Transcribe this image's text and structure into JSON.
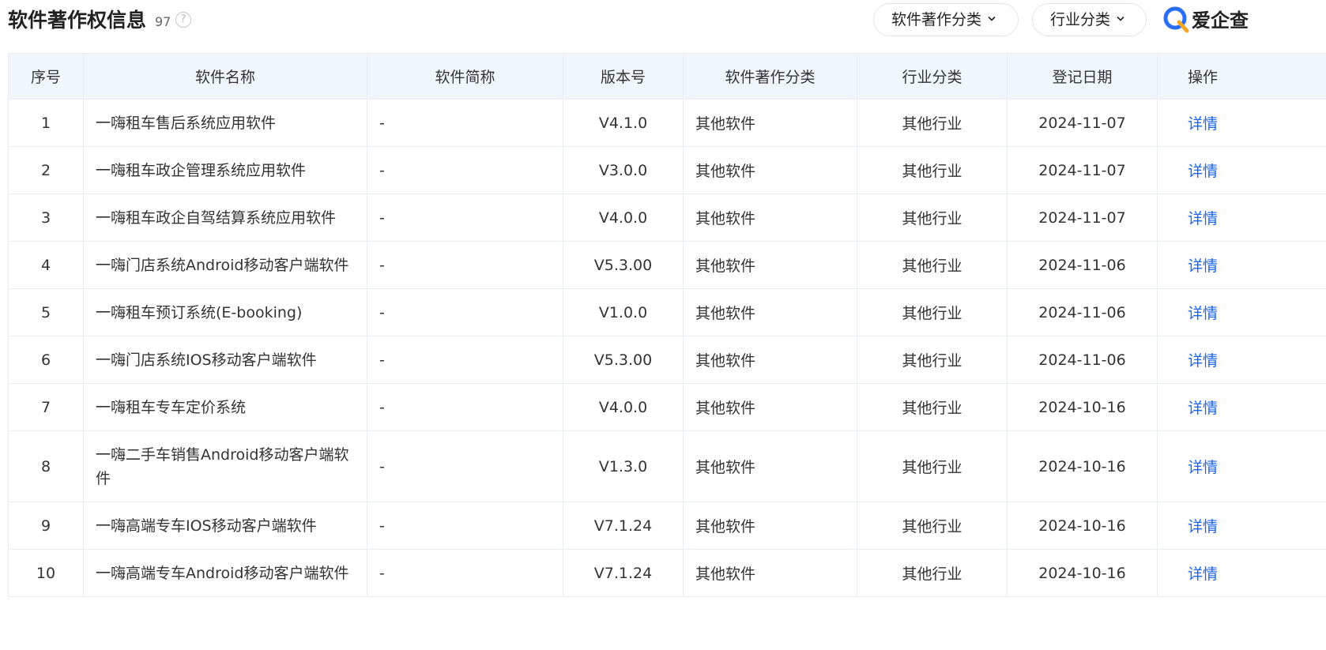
{
  "header": {
    "title": "软件著作权信息",
    "count": "97",
    "help_glyph": "?",
    "filters": [
      {
        "label": "软件著作分类",
        "icon": "chevron-down-icon"
      },
      {
        "label": "行业分类",
        "icon": "chevron-down-icon"
      }
    ],
    "brand": {
      "text": "爱企查",
      "logo_icon": "aiqicha-logo-icon",
      "accent": "#2a6ef5"
    }
  },
  "table": {
    "columns": [
      "序号",
      "软件名称",
      "软件简称",
      "版本号",
      "软件著作分类",
      "行业分类",
      "登记日期",
      "操作"
    ],
    "rows": [
      {
        "index": "1",
        "name": "一嗨租车售后系统应用软件",
        "abbr": "-",
        "version": "V4.1.0",
        "category": "其他软件",
        "industry": "其他行业",
        "date": "2024-11-07",
        "action": "详情"
      },
      {
        "index": "2",
        "name": "一嗨租车政企管理系统应用软件",
        "abbr": "-",
        "version": "V3.0.0",
        "category": "其他软件",
        "industry": "其他行业",
        "date": "2024-11-07",
        "action": "详情"
      },
      {
        "index": "3",
        "name": "一嗨租车政企自驾结算系统应用软件",
        "abbr": "-",
        "version": "V4.0.0",
        "category": "其他软件",
        "industry": "其他行业",
        "date": "2024-11-07",
        "action": "详情"
      },
      {
        "index": "4",
        "name": "一嗨门店系统Android移动客户端软件",
        "abbr": "-",
        "version": "V5.3.00",
        "category": "其他软件",
        "industry": "其他行业",
        "date": "2024-11-06",
        "action": "详情"
      },
      {
        "index": "5",
        "name": "一嗨租车预订系统(E-booking)",
        "abbr": "-",
        "version": "V1.0.0",
        "category": "其他软件",
        "industry": "其他行业",
        "date": "2024-11-06",
        "action": "详情"
      },
      {
        "index": "6",
        "name": "一嗨门店系统IOS移动客户端软件",
        "abbr": "-",
        "version": "V5.3.00",
        "category": "其他软件",
        "industry": "其他行业",
        "date": "2024-11-06",
        "action": "详情"
      },
      {
        "index": "7",
        "name": "一嗨租车专车定价系统",
        "abbr": "-",
        "version": "V4.0.0",
        "category": "其他软件",
        "industry": "其他行业",
        "date": "2024-10-16",
        "action": "详情"
      },
      {
        "index": "8",
        "name": "一嗨二手车销售Android移动客户端软件",
        "abbr": "-",
        "version": "V1.3.0",
        "category": "其他软件",
        "industry": "其他行业",
        "date": "2024-10-16",
        "action": "详情"
      },
      {
        "index": "9",
        "name": "一嗨高端专车IOS移动客户端软件",
        "abbr": "-",
        "version": "V7.1.24",
        "category": "其他软件",
        "industry": "其他行业",
        "date": "2024-10-16",
        "action": "详情"
      },
      {
        "index": "10",
        "name": "一嗨高端专车Android移动客户端软件",
        "abbr": "-",
        "version": "V7.1.24",
        "category": "其他软件",
        "industry": "其他行业",
        "date": "2024-10-16",
        "action": "详情"
      }
    ]
  },
  "colors": {
    "link": "#1a63f5",
    "header_bg": "#f1f6fd",
    "border": "#e9edf3"
  }
}
